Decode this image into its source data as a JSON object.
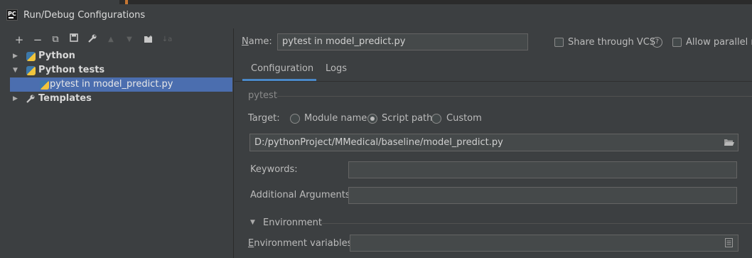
{
  "window": {
    "title": "Run/Debug Configurations",
    "app_icon_text": "PC"
  },
  "toolbar": {
    "add": "+",
    "remove": "−",
    "copy": "⧉",
    "save": "💾",
    "edit_templates": "🔧",
    "move_up": "▲",
    "move_down": "▼",
    "folder": "📁",
    "sort": "↓a"
  },
  "tree": {
    "items": [
      {
        "label": "Python",
        "expanded": false
      },
      {
        "label": "Python tests",
        "expanded": true
      },
      {
        "label": "pytest in model_predict.py",
        "selected": true
      },
      {
        "label": "Templates",
        "expanded": false
      }
    ]
  },
  "header": {
    "name_label_prefix": "N",
    "name_label_rest": "ame:",
    "name_value": "pytest in model_predict.py",
    "share_label": "Share through VCS",
    "share_checked": false,
    "help": "?",
    "parallel_label": "Allow parallel ru",
    "parallel_checked": false
  },
  "tabs": [
    {
      "label": "Configuration",
      "active": true
    },
    {
      "label": "Logs",
      "active": false
    }
  ],
  "config": {
    "section_title": "pytest",
    "target_label": "Target:",
    "target_options": [
      {
        "label": "Module name",
        "selected": false
      },
      {
        "label": "Script path",
        "selected": true
      },
      {
        "label": "Custom",
        "selected": false
      }
    ],
    "script_path": "D:/pythonProject/MMedical/baseline/model_predict.py",
    "keywords_label": "Keywords:",
    "keywords_value": "",
    "args_label": "Additional Arguments:",
    "args_value": "",
    "environment_title": "Environment",
    "env_vars_label_prefix": "E",
    "env_vars_label_rest": "nvironment variables:",
    "env_vars_value": ""
  },
  "colors": {
    "selection": "#4b6eaf",
    "tab_underline": "#4a88c7",
    "background": "#3c3f41"
  }
}
